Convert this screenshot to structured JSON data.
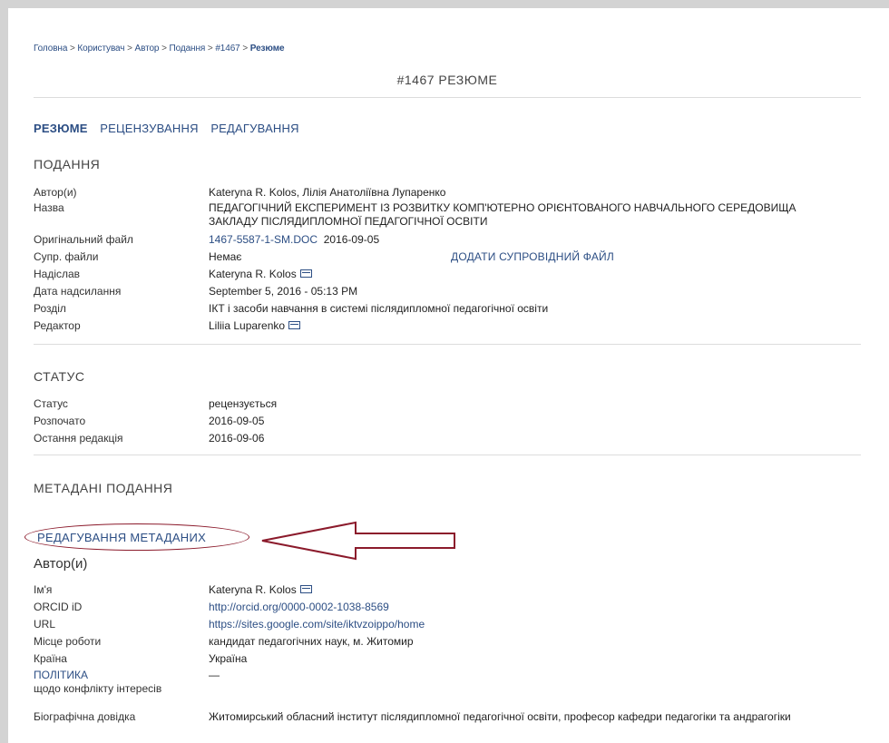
{
  "breadcrumb": {
    "items": [
      "Головна",
      "Користувач",
      "Автор",
      "Подання",
      "#1467"
    ],
    "separator": ">",
    "current": "Резюме"
  },
  "page_title": "#1467 РЕЗЮМЕ",
  "tabs": {
    "summary": "РЕЗЮМЕ",
    "review": "РЕЦЕНЗУВАННЯ",
    "editing": "РЕДАГУВАННЯ"
  },
  "submission": {
    "title": "ПОДАННЯ",
    "rows": {
      "authors": {
        "label": "Автор(и)",
        "value": "Kateryna R. Kolos, Лілія Анатоліївна Лупаренко"
      },
      "name": {
        "label": "Назва",
        "value": "ПЕДАГОГІЧНИЙ ЕКСПЕРИМЕНТ ІЗ РОЗВИТКУ КОМП'ЮТЕРНО ОРІЄНТОВАНОГО НАВЧАЛЬНОГО СЕРЕДОВИЩА ЗАКЛАДУ ПІСЛЯДИПЛОМНОЇ ПЕДАГОГІЧНОЇ ОСВІТИ"
      },
      "original_file": {
        "label": "Оригінальний файл",
        "file": "1467-5587-1-SM.DOC",
        "date": "2016-09-05"
      },
      "supp_files": {
        "label": "Супр. файли",
        "value": "Немає",
        "action": "ДОДАТИ СУПРОВІДНИЙ ФАЙЛ"
      },
      "submitter": {
        "label": "Надіслав",
        "value": "Kateryna R. Kolos"
      },
      "date_submitted": {
        "label": "Дата надсилання",
        "value": "September 5, 2016 - 05:13 PM"
      },
      "section": {
        "label": "Розділ",
        "value": "ІКТ і засоби навчання в системі післядипломної педагогічної освіти"
      },
      "editor": {
        "label": "Редактор",
        "value": "Liliia Luparenko"
      }
    }
  },
  "status": {
    "title": "СТАТУС",
    "rows": {
      "status": {
        "label": "Статус",
        "value": "рецензується"
      },
      "started": {
        "label": "Розпочато",
        "value": "2016-09-05"
      },
      "last_edited": {
        "label": "Остання редакція",
        "value": "2016-09-06"
      }
    }
  },
  "metadata": {
    "title": "МЕТАДАНІ ПОДАННЯ",
    "edit_link": "РЕДАГУВАННЯ МЕТАДАНИХ",
    "annotation_color": "#8b1a2b",
    "authors_title": "Автор(и)",
    "rows": {
      "name": {
        "label": "Ім'я",
        "value": "Kateryna R. Kolos"
      },
      "orcid": {
        "label": "ORCID iD",
        "value": "http://orcid.org/0000-0002-1038-8569"
      },
      "url": {
        "label": "URL",
        "value": "https://sites.google.com/site/iktvzoippo/home"
      },
      "workplace": {
        "label": "Місце роботи",
        "value": "кандидат педагогічних наук, м. Житомир"
      },
      "country": {
        "label": "Країна",
        "value": "Україна"
      },
      "policy": {
        "label_link": "ПОЛІТИКА",
        "label_rest": "щодо конфлікту інтересів",
        "value": "—"
      },
      "bio": {
        "label": "Біографічна довідка",
        "value": "Житомирський обласний інститут післядипломної педагогічної освіти, професор кафедри педагогіки та андрагогіки"
      }
    }
  },
  "colors": {
    "link": "#2c4e84",
    "divider": "#dcdcdc",
    "frame": "#d3d3d3"
  }
}
